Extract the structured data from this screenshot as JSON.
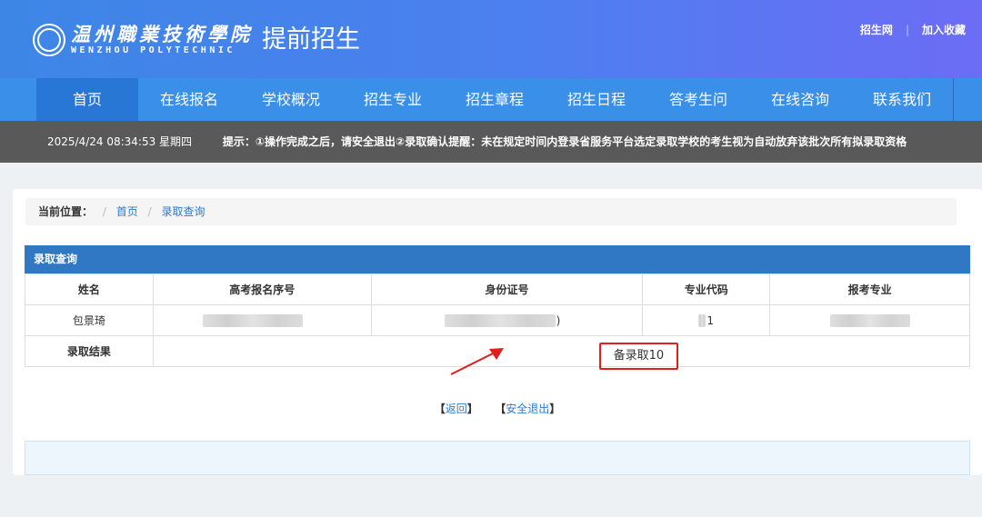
{
  "header": {
    "logo_cn": "温州職業技術學院",
    "logo_en": "WENZHOU POLYTECHNIC",
    "title": "提前招生",
    "links": [
      "招生网",
      "加入收藏"
    ]
  },
  "nav": {
    "items": [
      "首页",
      "在线报名",
      "学校概况",
      "招生专业",
      "招生章程",
      "招生日程",
      "答考生问",
      "在线咨询",
      "联系我们"
    ],
    "active_index": 0
  },
  "notice": {
    "datetime": "2025/4/24 08:34:53 星期四",
    "tip": "提示：①操作完成之后，请安全退出②录取确认提醒：未在规定时间内登录省服务平台选定录取学校的考生视为自动放弃该批次所有拟录取资格"
  },
  "breadcrumb": {
    "label": "当前位置：",
    "items": [
      "首页",
      "录取查询"
    ]
  },
  "result": {
    "title": "录取查询",
    "columns": [
      "姓名",
      "高考报名序号",
      "身份证号",
      "专业代码",
      "报考专业"
    ],
    "row": {
      "name": "包景琦",
      "id_suffix": ")",
      "code_suffix": "1"
    },
    "admission_label": "录取结果",
    "admission_value": "备录取10"
  },
  "actions": {
    "back": "返回",
    "logout": "安全退出"
  },
  "colors": {
    "header_start": "#3d86e6",
    "header_end": "#6c6cf5",
    "nav": "#3a8fe8",
    "nav_active": "#2877d6",
    "notice_bg": "#595959",
    "table_head": "#3078c4",
    "highlight": "#e01f1f"
  }
}
